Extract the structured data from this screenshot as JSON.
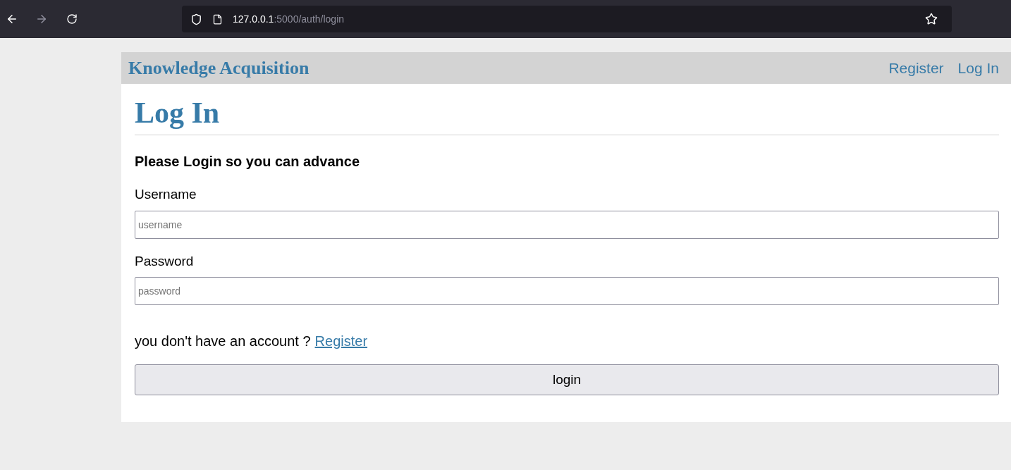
{
  "browser": {
    "url_host": "127.0.0.1",
    "url_path": ":5000/auth/login"
  },
  "nav": {
    "brand": "Knowledge Acquisition",
    "links": [
      "Register",
      "Log In"
    ]
  },
  "page": {
    "title": "Log In",
    "subtitle": "Please Login so you can advance",
    "fields": [
      {
        "label": "Username",
        "placeholder": "username"
      },
      {
        "label": "Password",
        "placeholder": "password"
      }
    ],
    "register_prompt": "you don't have an account ?",
    "register_link": "Register",
    "submit": "login"
  }
}
